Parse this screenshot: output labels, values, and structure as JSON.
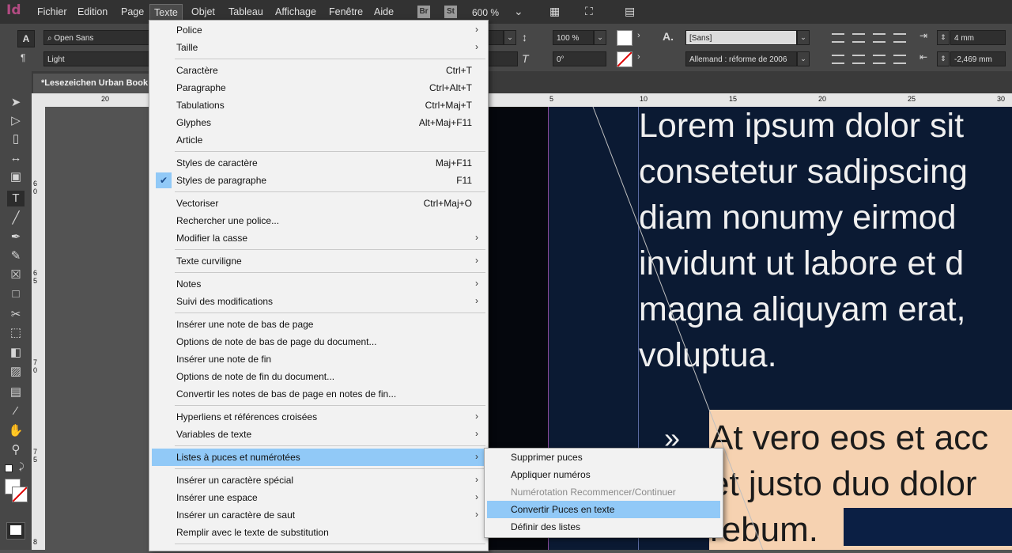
{
  "app": {
    "logo": "Id"
  },
  "menubar": {
    "items": [
      "Fichier",
      "Edition",
      "Page",
      "Texte",
      "Objet",
      "Tableau",
      "Affichage",
      "Fenêtre",
      "Aide"
    ],
    "br": "Br",
    "st": "St",
    "zoom": "600 %"
  },
  "control": {
    "font_family": "Open Sans",
    "font_style": "Light",
    "scale_v": "100 %",
    "skew": "0°",
    "char_style": "[Sans]",
    "language": "Allemand : réforme de 2006",
    "indent": "4 mm",
    "indent2": "-2,469 mm"
  },
  "document": {
    "tab_title": "*Lesezeichen Urban Book"
  },
  "rulers": {
    "h_left": [
      "20"
    ],
    "h_right": [
      "5",
      "10",
      "15",
      "20",
      "25",
      "30"
    ],
    "v": [
      "6 0",
      "6 5",
      "7 0",
      "7 5",
      "8"
    ]
  },
  "canvas": {
    "body_text": "Lorem ipsum dolor sit\nconsetetur sadipscing\ndiam nonumy eirmod\ninvidunt ut labore et d\nmagna aliquyam erat,\nvoluptua.",
    "bullet": "»",
    "bullet_text": "At vero eos et acc\net justo duo dolor\nrebum."
  },
  "menu": {
    "items": [
      {
        "label": "Police",
        "shortcut": "",
        "submenu": true
      },
      {
        "label": "Taille",
        "shortcut": "",
        "submenu": true
      },
      {
        "label": "Caractère",
        "shortcut": "Ctrl+T",
        "submenu": false
      },
      {
        "label": "Paragraphe",
        "shortcut": "Ctrl+Alt+T",
        "submenu": false
      },
      {
        "label": "Tabulations",
        "shortcut": "Ctrl+Maj+T",
        "submenu": false
      },
      {
        "label": "Glyphes",
        "shortcut": "Alt+Maj+F11",
        "submenu": false
      },
      {
        "label": "Article",
        "shortcut": "",
        "submenu": false
      },
      {
        "label": "Styles de caractère",
        "shortcut": "Maj+F11",
        "submenu": false
      },
      {
        "label": "Styles de paragraphe",
        "shortcut": "F11",
        "submenu": false,
        "checked": true
      },
      {
        "label": "Vectoriser",
        "shortcut": "Ctrl+Maj+O",
        "submenu": false
      },
      {
        "label": "Rechercher une police...",
        "shortcut": "",
        "submenu": false
      },
      {
        "label": "Modifier la casse",
        "shortcut": "",
        "submenu": true
      },
      {
        "label": "Texte curviligne",
        "shortcut": "",
        "submenu": true
      },
      {
        "label": "Notes",
        "shortcut": "",
        "submenu": true
      },
      {
        "label": "Suivi des modifications",
        "shortcut": "",
        "submenu": true
      },
      {
        "label": "Insérer une note de bas de page",
        "shortcut": "",
        "submenu": false
      },
      {
        "label": "Options de note de bas de page du document...",
        "shortcut": "",
        "submenu": false
      },
      {
        "label": "Insérer une note de fin",
        "shortcut": "",
        "submenu": false
      },
      {
        "label": "Options de note de fin du document...",
        "shortcut": "",
        "submenu": false
      },
      {
        "label": "Convertir les notes de bas de page en notes de fin...",
        "shortcut": "",
        "submenu": false
      },
      {
        "label": "Hyperliens et références croisées",
        "shortcut": "",
        "submenu": true
      },
      {
        "label": "Variables de texte",
        "shortcut": "",
        "submenu": true
      },
      {
        "label": "Listes à puces et numérotées",
        "shortcut": "",
        "submenu": true,
        "highlighted": true
      },
      {
        "label": "Insérer un caractère spécial",
        "shortcut": "",
        "submenu": true
      },
      {
        "label": "Insérer une espace",
        "shortcut": "",
        "submenu": true
      },
      {
        "label": "Insérer un caractère de saut",
        "shortcut": "",
        "submenu": true
      },
      {
        "label": "Remplir avec le texte de substitution",
        "shortcut": "",
        "submenu": false
      }
    ]
  },
  "submenu": {
    "items": [
      {
        "label": "Supprimer puces",
        "disabled": false
      },
      {
        "label": "Appliquer numéros",
        "disabled": false
      },
      {
        "label": "Numérotation Recommencer/Continuer",
        "disabled": true
      },
      {
        "label": "Convertir Puces en texte",
        "disabled": false,
        "highlighted": true
      },
      {
        "label": "Définir des listes",
        "disabled": false
      }
    ]
  },
  "colors": {
    "accent": "#91c9f7",
    "logo": "#b24b82",
    "canvas_dark": "#0b1a33",
    "peach": "#f6d2b1"
  }
}
